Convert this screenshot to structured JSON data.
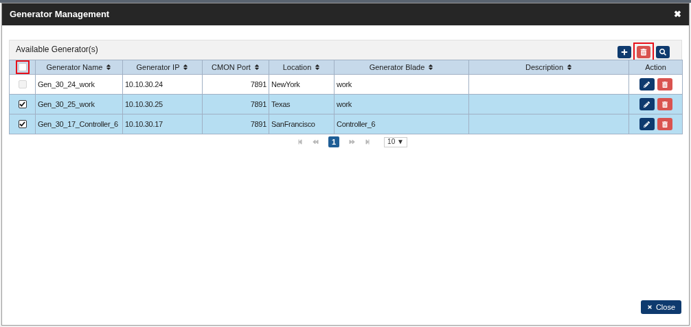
{
  "window": {
    "title": "Generator Management",
    "close": "✖"
  },
  "panel": {
    "title": "Available Generator(s)",
    "toolbar": [
      {
        "kind": "add",
        "highlighted": false
      },
      {
        "kind": "delete",
        "highlighted": true
      },
      {
        "kind": "search",
        "highlighted": false
      }
    ]
  },
  "table": {
    "select_all": {
      "checked": false,
      "highlighted": true
    },
    "columns": [
      {
        "label": "Generator Name",
        "numeric": false
      },
      {
        "label": "Generator IP",
        "numeric": false
      },
      {
        "label": "CMON Port",
        "numeric": true
      },
      {
        "label": "Location",
        "numeric": false
      },
      {
        "label": "Generator Blade",
        "numeric": false
      },
      {
        "label": "Description"
      }
    ],
    "action_column": "Action",
    "rows": [
      {
        "cells": [
          "Gen_30_24_work",
          "10.10.30.24",
          "7891",
          "NewYork",
          "work",
          ""
        ],
        "checked": false,
        "disabled": true,
        "selected": false
      },
      {
        "cells": [
          "Gen_30_25_work",
          "10.10.30.25",
          "7891",
          "Texas",
          "work",
          ""
        ],
        "checked": true,
        "disabled": false,
        "selected": true
      },
      {
        "cells": [
          "Gen_30_17_Controller_6",
          "10.10.30.17",
          "7891",
          "SanFrancisco",
          "Controller_6",
          ""
        ],
        "checked": true,
        "disabled": false,
        "selected": true
      }
    ]
  },
  "pagination": {
    "pages": [
      {
        "label": "1",
        "selected": true
      }
    ],
    "page_size": "10 ▼"
  },
  "buttons": [
    {
      "label": "Close"
    }
  ]
}
